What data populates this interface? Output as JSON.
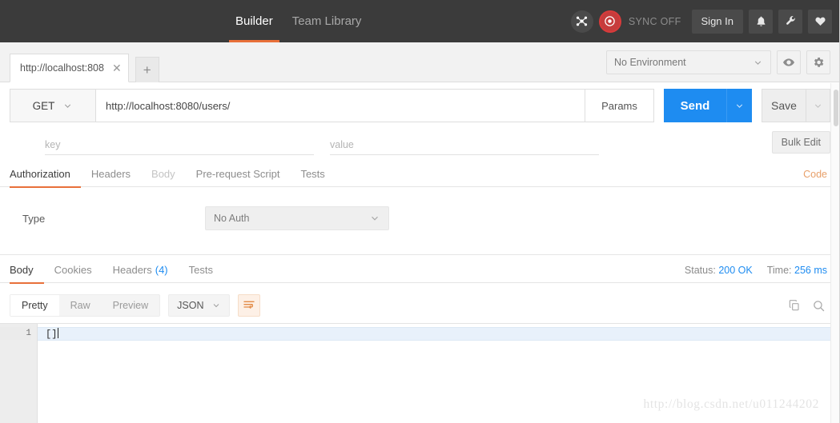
{
  "topbar": {
    "nav": [
      {
        "label": "Builder",
        "active": true
      },
      {
        "label": "Team Library",
        "active": false
      }
    ],
    "network_icon": "network-hexagon-icon",
    "sync_icon": "sync-circle-icon",
    "sync_label": "SYNC OFF",
    "signin_label": "Sign In",
    "bell_icon": "bell-icon",
    "wrench_icon": "wrench-icon",
    "heart_icon": "heart-icon",
    "background": "#3b3b3b",
    "accent": "#e8703a"
  },
  "tabstrip": {
    "request_tab_title": "http://localhost:808",
    "close_glyph": "✕",
    "add_glyph": "+",
    "environment_value": "No Environment",
    "eye_icon": "eye-icon",
    "gear_icon": "gear-icon"
  },
  "url_row": {
    "method": "GET",
    "url_value": "http://localhost:8080/users/",
    "params_label": "Params",
    "send_label": "Send",
    "save_label": "Save",
    "send_color": "#1e8cf1"
  },
  "params_row": {
    "key_placeholder": "key",
    "key_value": "",
    "value_placeholder": "value",
    "value_value": "",
    "bulk_edit_label": "Bulk Edit"
  },
  "request_tabs": {
    "items": [
      {
        "label": "Authorization",
        "state": "active"
      },
      {
        "label": "Headers",
        "state": "normal"
      },
      {
        "label": "Body",
        "state": "dim"
      },
      {
        "label": "Pre-request Script",
        "state": "normal"
      },
      {
        "label": "Tests",
        "state": "normal"
      }
    ],
    "code_link": "Code"
  },
  "auth_pane": {
    "type_label": "Type",
    "type_value": "No Auth"
  },
  "response_tabs": {
    "items": [
      {
        "label": "Body",
        "state": "active",
        "count": ""
      },
      {
        "label": "Cookies",
        "state": "normal",
        "count": ""
      },
      {
        "label": "Headers",
        "state": "normal",
        "count": "(4)"
      },
      {
        "label": "Tests",
        "state": "normal",
        "count": ""
      }
    ],
    "status_label": "Status:",
    "status_value": "200 OK",
    "time_label": "Time:",
    "time_value": "256 ms",
    "value_color": "#1e8cf1"
  },
  "view_toolbar": {
    "segments": [
      {
        "label": "Pretty",
        "active": true
      },
      {
        "label": "Raw",
        "active": false
      },
      {
        "label": "Preview",
        "active": false
      }
    ],
    "format_value": "JSON",
    "wrap_icon": "word-wrap-icon",
    "copy_icon": "copy-icon",
    "search_icon": "search-icon"
  },
  "editor": {
    "line_numbers": [
      "1"
    ],
    "lines": [
      "[]"
    ],
    "watermark": "http://blog.csdn.net/u011244202"
  }
}
